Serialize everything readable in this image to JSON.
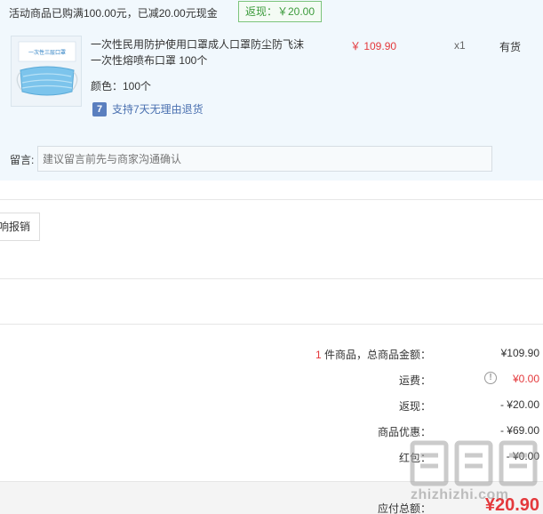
{
  "promo": {
    "text": "活动商品已购满100.00元，已减20.00元现金",
    "rebate_tag": "返现：￥20.00"
  },
  "product": {
    "name": "一次性民用防护使用口罩成人口罩防尘防飞沫一次性熔喷布口罩 100个",
    "price": "￥ 109.90",
    "qty": "x1",
    "stock": "有货",
    "attr": "颜色：100个",
    "return_icon": "7",
    "return_policy": "支持7天无理由退货",
    "thumb_text": "一次性三层口罩"
  },
  "note": {
    "label": "留言:",
    "placeholder": "建议留言前先与商家沟通确认"
  },
  "invoice": {
    "button_label": "响报销"
  },
  "summary": {
    "items_count": "1",
    "items_label": "件商品，总商品金额：",
    "items_value": "¥109.90",
    "shipping_label": "运费：",
    "shipping_value": "¥0.00",
    "rebate_label": "返现：",
    "rebate_value": "- ¥20.00",
    "discount_label": "商品优惠：",
    "discount_value": "- ¥69.00",
    "redpacket_label": "红包：",
    "redpacket_value": "- ¥0.00"
  },
  "total": {
    "label": "应付总额：",
    "value": "¥20.90"
  },
  "watermark": {
    "text": "zhizhizhi.com"
  },
  "colors": {
    "accent_red": "#e4393c",
    "panel_bg": "#f1f8fd",
    "rebate_green": "#3c9b3c",
    "link_blue": "#4a70b0"
  }
}
